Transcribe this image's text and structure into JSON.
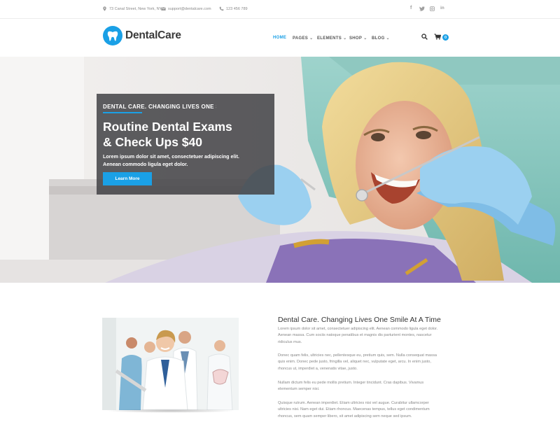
{
  "topbar": {
    "address": "73 Canal Street, New York, NY",
    "email": "support@dentalcare.com",
    "phone": "123 456 789",
    "social": [
      "facebook-icon",
      "twitter-icon",
      "instagram-icon",
      "linkedin-icon"
    ]
  },
  "header": {
    "logo_prefix": "Dental",
    "logo_suffix": "Care",
    "nav": [
      {
        "label": "HOME",
        "active": true
      },
      {
        "label": "PAGES",
        "has_dropdown": true
      },
      {
        "label": "ELEMENTS",
        "has_dropdown": true
      },
      {
        "label": "SHOP",
        "has_dropdown": true
      },
      {
        "label": "BLOG",
        "has_dropdown": true
      }
    ],
    "cart_count": "0"
  },
  "slider": {
    "tagline": "DENTAL CARE. CHANGING LIVES ONE SMILE AT A TIME",
    "title_line1": "Routine Dental Exams",
    "title_line2": "& Check Ups $40",
    "text_line1": "Lorem ipsum dolor sit amet, consectetuer adipiscing elit.",
    "text_line2": "Aenean commodo ligula eget dolor.",
    "button": "Learn More"
  },
  "about": {
    "title": "Dental Care. Changing Lives One Smile At A Time",
    "p1": [
      "Lorem ipsum dolor sit amet, consectetuer adipiscing elit. Aenean commodo ligula eget dolor.",
      "Aenean massa. Cum sociis natoque penatibus et magnis dis parturient montes, nascetur",
      "ridiculus mus."
    ],
    "p2": [
      "Donec quam felis, ultricies nec, pellentesque eu, pretium quis, sem. Nulla consequat massa",
      "quis enim. Donec pede justo, fringilla vel, aliquet nec, vulputate eget, arcu. In enim justo,",
      "rhoncus ut, imperdiet a, venenatis vitae, justo."
    ],
    "p3": [
      "Nullam dictum felis eu pede mollis pretium. Integer tincidunt. Cras dapibus. Vivamus",
      "elementum semper nisi."
    ],
    "p4": [
      "Quisque rutrum. Aenean imperdiet. Etiam ultricies nisi vel augue. Curabitur ullamcorper",
      "ultricies nisi. Nam eget dui. Etiam rhoncus. Maecenas tempus, tellus eget condimentum",
      "rhoncus, sem quam semper libero, sit amet adipiscing sem neque sed ipsum."
    ]
  },
  "colors": {
    "accent": "#1aa0e6",
    "slider_box": "#424246"
  }
}
